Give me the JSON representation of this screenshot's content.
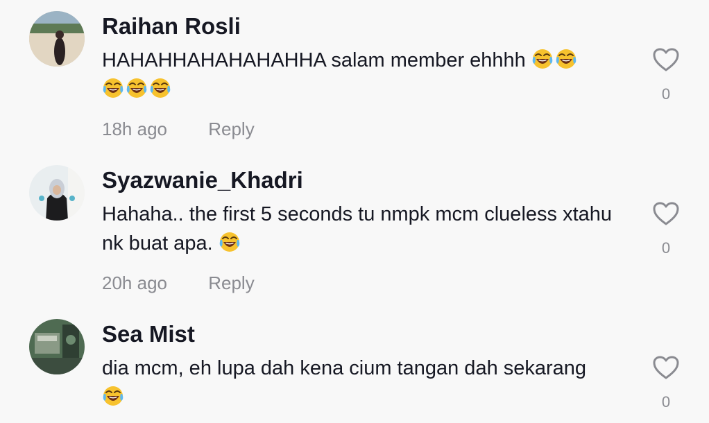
{
  "comments": [
    {
      "username": "Raihan Rosli",
      "text": "HAHAHHAHAHAHAHHA salam member ehhhh",
      "emoji_count": 5,
      "emoji_icon": "face-with-tears-of-joy-emoji",
      "time": "18h ago",
      "reply_label": "Reply",
      "likes": "0"
    },
    {
      "username": "Syazwanie_Khadri",
      "text": "Hahaha.. the first 5 seconds tu nmpk mcm clueless xtahu nk buat apa.",
      "emoji_count": 1,
      "emoji_icon": "face-with-tears-of-joy-emoji",
      "time": "20h ago",
      "reply_label": "Reply",
      "likes": "0"
    },
    {
      "username": "Sea Mist",
      "text": "dia mcm, eh lupa dah kena cium tangan dah sekarang",
      "emoji_count": 1,
      "emoji_icon": "face-with-tears-of-joy-emoji",
      "time": "",
      "reply_label": "",
      "likes": "0"
    }
  ],
  "like_icon": "heart-outline-icon",
  "colors": {
    "background": "#f8f8f8",
    "username": "#161823",
    "meta": "#8a8b91"
  }
}
